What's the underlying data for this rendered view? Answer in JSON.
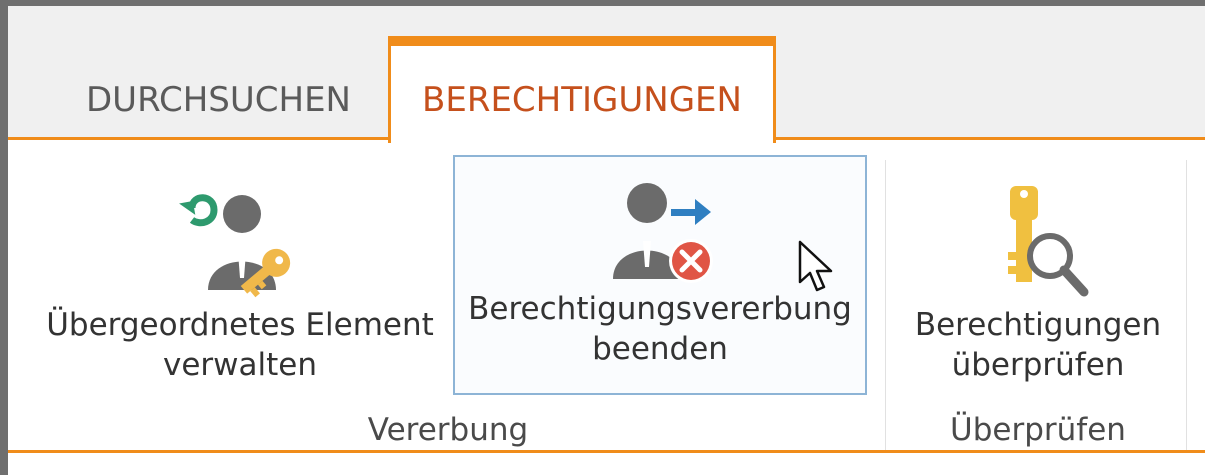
{
  "tabs": [
    {
      "label": "DURCHSUCHEN",
      "active": false
    },
    {
      "label": "BERECHTIGUNGEN",
      "active": true
    }
  ],
  "ribbon": {
    "buttons": {
      "manage_parent": {
        "line1": "Übergeordnetes Element",
        "line2": "verwalten",
        "icon": "manage-parent-permissions-icon"
      },
      "stop_inheriting": {
        "line1": "Berechtigungsvererbung",
        "line2": "beenden",
        "icon": "stop-inheriting-permissions-icon"
      },
      "check_permissions": {
        "line1": "Berechtigungen",
        "line2": "überprüfen",
        "icon": "check-permissions-icon"
      }
    },
    "groups": {
      "inheritance": "Vererbung",
      "check": "Überprüfen"
    }
  },
  "colors": {
    "accent": "#f08c1a",
    "active_tab_text": "#c5501c",
    "hover_border": "#8db4d6",
    "arrow_green": "#2e9a6e",
    "arrow_blue": "#2f7fc1",
    "error_red": "#e05545",
    "key_yellow": "#f0c040"
  }
}
